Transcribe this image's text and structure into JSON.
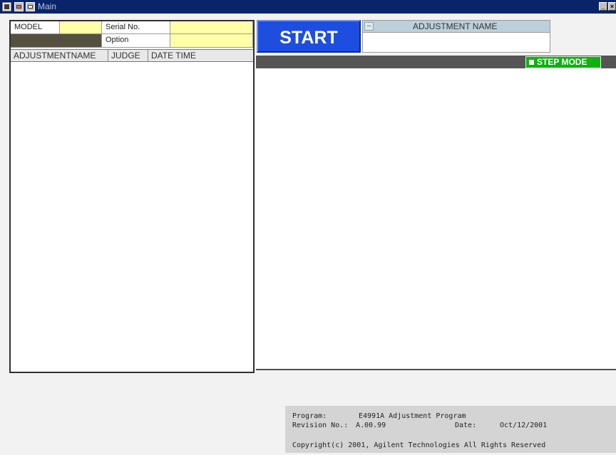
{
  "window": {
    "title": "Main",
    "min_glyph": "_",
    "close_glyph": "×"
  },
  "fields": {
    "model_label": "MODEL",
    "model_value": "",
    "serial_label": "Serial No.",
    "serial_value": "",
    "option_label": "Option",
    "option_value": ""
  },
  "table": {
    "columns": [
      "ADJUSTMENTNAME",
      "JUDGE",
      "DATE TIME"
    ]
  },
  "start_button": "START",
  "adjustment": {
    "header_label": "ADJUSTMENT NAME",
    "toggle_glyph": "–",
    "value": ""
  },
  "step_mode": "STEP MODE",
  "info": {
    "program_label": "Program:",
    "program_value": "E4991A Adjustment Program",
    "revision_label": "Revision No.:",
    "revision_value": "A.00.99",
    "date_label": "Date:",
    "date_value": "Oct/12/2001",
    "copyright": "Copyright(c) 2001, Agilent Technologies All Rights Reserved"
  },
  "colors": {
    "title_bar": "#0a246a",
    "start_bg": "#1e4ee0",
    "step_mode_bg": "#10b010",
    "field_yellow": "#ffffa8"
  }
}
